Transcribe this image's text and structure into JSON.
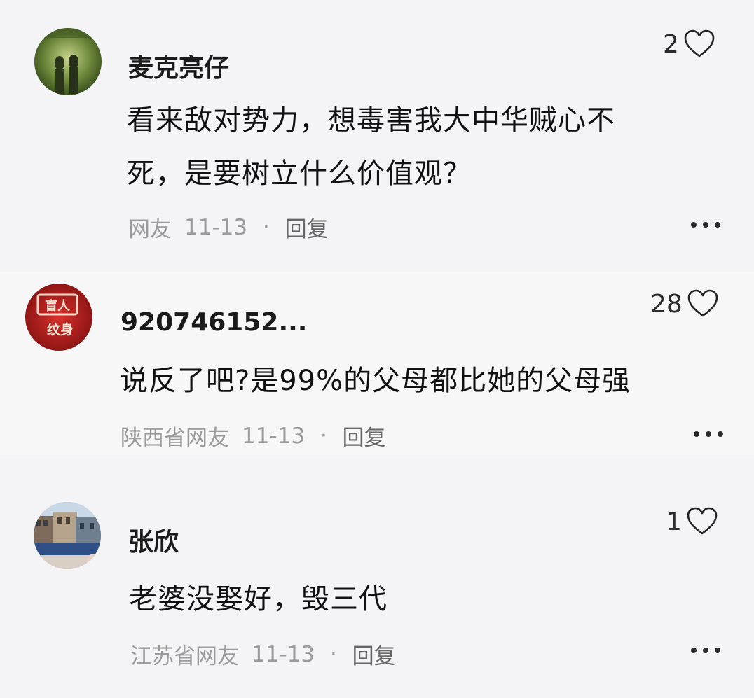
{
  "comments": [
    {
      "username": "麦克亮仔",
      "likes": "2",
      "text_lines": [
        "看来敌对势力，想毒害我大中华贼心不",
        "死，是要树立什么价值观？"
      ],
      "location": "网友",
      "date": "11-13",
      "separator": "·",
      "reply_label": "回复",
      "avatar_icon": "forest-silhouette-avatar"
    },
    {
      "username": "920746152...",
      "likes": "28",
      "text_lines": [
        "说反了吧?是99%的父母都比她的父母强"
      ],
      "location": "陕西省网友",
      "date": "11-13",
      "separator": "·",
      "reply_label": "回复",
      "avatar_icon": "neon-sign-avatar",
      "avatar_sign_top": "盲人",
      "avatar_sign_bottom": "纹身"
    },
    {
      "username": "张欣",
      "likes": "1",
      "text_lines": [
        "老婆没娶好，毁三代"
      ],
      "location": "江苏省网友",
      "date": "11-13",
      "separator": "·",
      "reply_label": "回复",
      "avatar_icon": "street-photo-avatar"
    }
  ],
  "colors": {
    "background": "#f4f4f6",
    "meta_text": "#9a9a9a",
    "body_text": "#111111"
  }
}
